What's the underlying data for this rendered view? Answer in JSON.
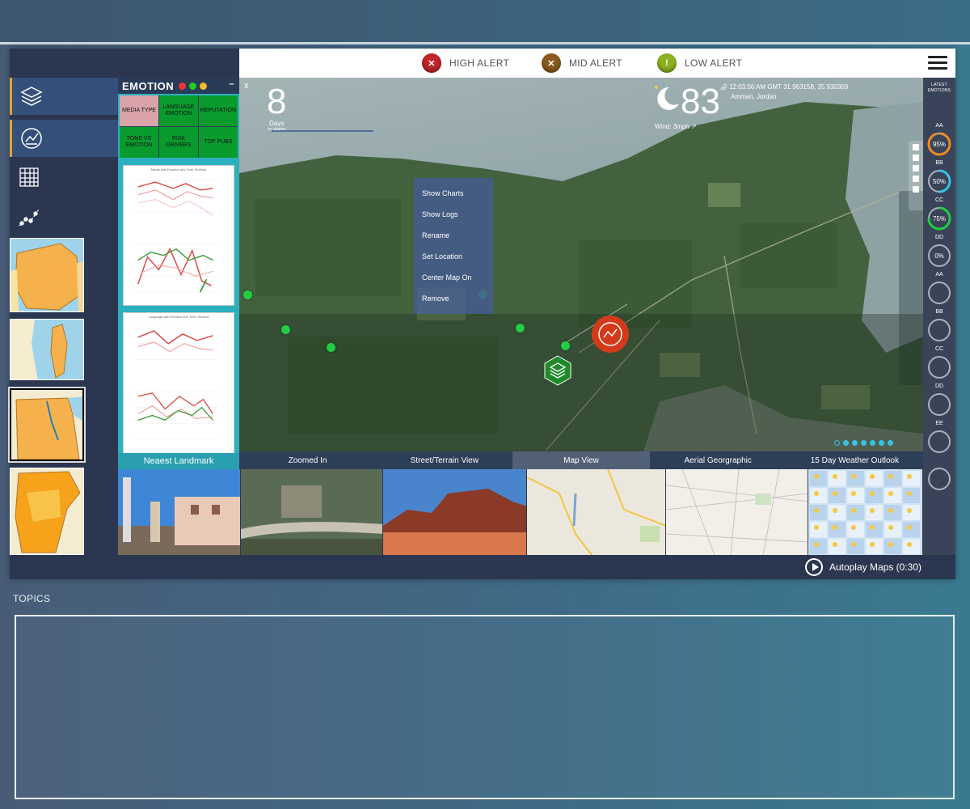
{
  "alerts": {
    "high": {
      "label": "HIGH ALERT",
      "icon": "✕",
      "color": "#c0262b"
    },
    "mid": {
      "label": "MID ALERT",
      "icon": "✕",
      "color": "#8a5a1e"
    },
    "low": {
      "label": "LOW ALERT",
      "icon": "!",
      "color": "#8db21f"
    }
  },
  "emotion_panel": {
    "title": "EMOTION",
    "cells": [
      "MEDIA TYPE",
      "LANGUAGE EMOTION",
      "REPUTATION",
      "TONE VS EMOTION",
      "Risk DRIVERS",
      "TOP PUBS"
    ],
    "chart1_title": "Media with Emotion and Tone Timeline",
    "chart2_title": "Language with Emotion and Tone Timeline",
    "landmark_label": "Neaest Landmark"
  },
  "map": {
    "close": "x",
    "days_value": "8",
    "days_label": "Days",
    "days_sub": "no alarms",
    "temperature": "83",
    "degree": "°",
    "wind": "Wind: 3mph",
    "time_coords": "12:03:56 AM GMT   31.963158, 35.930359",
    "location": "Amman, Jordan",
    "context_menu": [
      "Show Charts",
      "Show Logs",
      "Rename",
      "Set Location",
      "Center Map On",
      "Remove"
    ]
  },
  "views": {
    "tabs": [
      "Zoomed In",
      "Street/Terrain View",
      "Map View",
      "Aerial Georgraphic",
      "15 Day Weather Outlook"
    ],
    "active_tab": "Map View"
  },
  "right_panel": {
    "title_line1": "LATEST",
    "title_line2": "EMOTIONS",
    "items": [
      {
        "label": "AA",
        "value": "95%",
        "fraction": 0.95,
        "color": "#f08a24"
      },
      {
        "label": "BB",
        "value": "50%",
        "fraction": 0.5,
        "color": "#36c3e6"
      },
      {
        "label": "CC",
        "value": "75%",
        "fraction": 0.75,
        "color": "#22cc44"
      },
      {
        "label": "DD",
        "value": "0%",
        "fraction": 0,
        "color": "#ffffff"
      },
      {
        "label": "AA",
        "value": "",
        "fraction": 0,
        "color": "#ffffff"
      },
      {
        "label": "BB",
        "value": "",
        "fraction": 0,
        "color": "#ffffff"
      },
      {
        "label": "CC",
        "value": "",
        "fraction": 0,
        "color": "#ffffff"
      },
      {
        "label": "DD",
        "value": "",
        "fraction": 0,
        "color": "#ffffff"
      },
      {
        "label": "EE",
        "value": "",
        "fraction": 0,
        "color": "#ffffff"
      },
      {
        "label": "",
        "value": "",
        "fraction": 0,
        "color": "#ffffff"
      }
    ]
  },
  "autoplay": {
    "label": "Autoplay Maps (0:30)"
  },
  "topics": {
    "label": "TOPICS"
  }
}
